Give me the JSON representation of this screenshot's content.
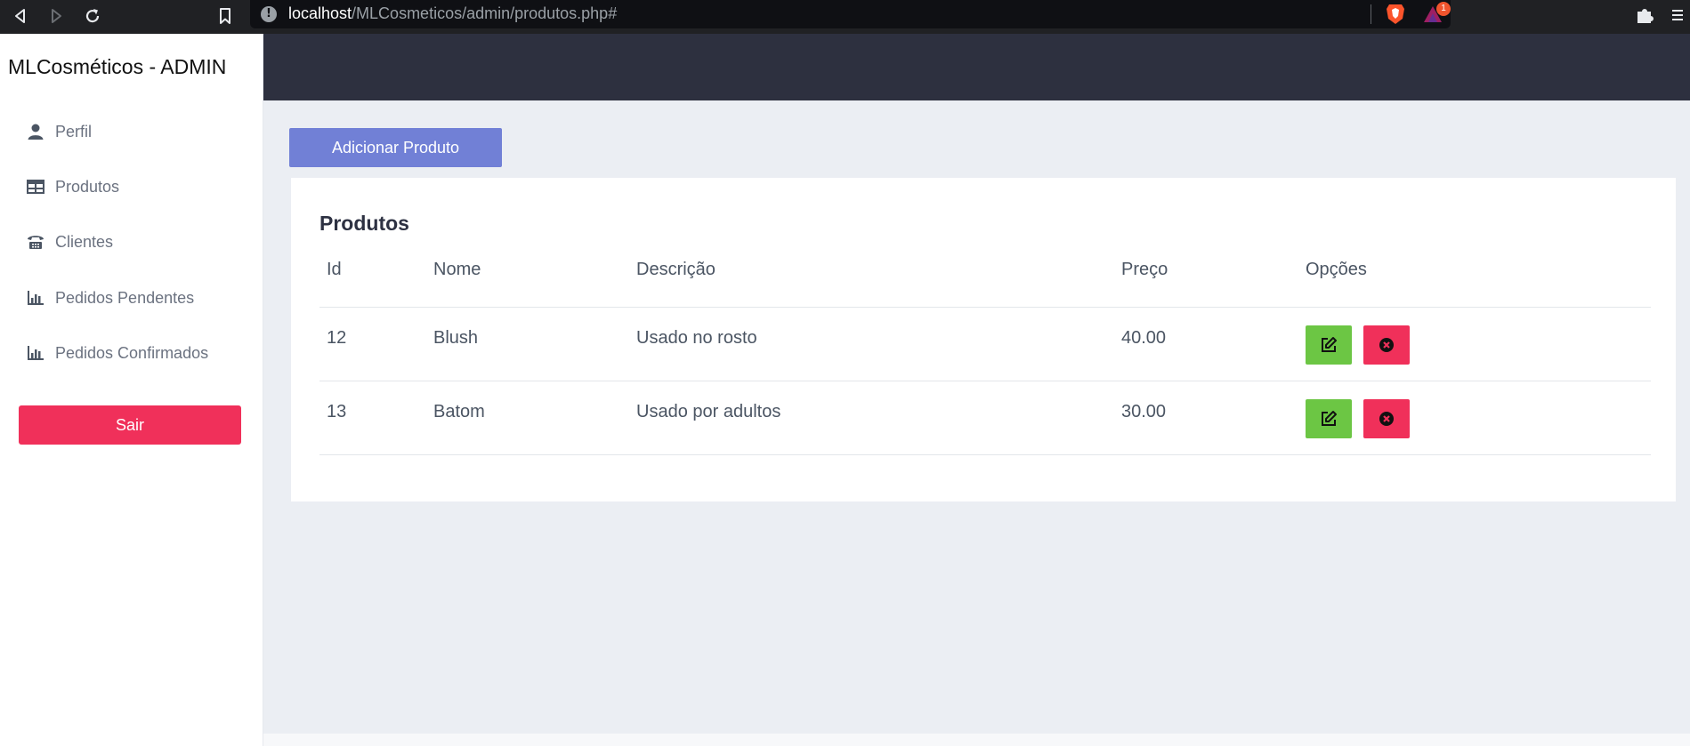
{
  "browser": {
    "url_host": "localhost",
    "url_path": "/MLCosmeticos/admin/produtos.php#",
    "rewards_badge": "1",
    "info_icon": "info-icon",
    "colors": {
      "chrome_bg": "#202124",
      "url_bg": "#0f1014",
      "brave_orange": "#fb542b"
    }
  },
  "sidebar": {
    "brand": "MLCosméticos - ADMIN",
    "items": [
      {
        "label": "Perfil",
        "icon": "user-icon"
      },
      {
        "label": "Produtos",
        "icon": "table-icon"
      },
      {
        "label": "Clientes",
        "icon": "phone-icon"
      },
      {
        "label": "Pedidos Pendentes",
        "icon": "bar-chart-icon"
      },
      {
        "label": "Pedidos Confirmados",
        "icon": "bar-chart-icon"
      }
    ],
    "logout_label": "Sair"
  },
  "main": {
    "add_button_label": "Adicionar Produto",
    "card_title": "Produtos",
    "columns": [
      "Id",
      "Nome",
      "Descrição",
      "Preço",
      "Opções"
    ],
    "rows": [
      {
        "id": "12",
        "nome": "Blush",
        "descricao": "Usado no rosto",
        "preco": "40.00"
      },
      {
        "id": "13",
        "nome": "Batom",
        "descricao": "Usado por adultos",
        "preco": "30.00"
      }
    ],
    "row_actions": [
      {
        "name": "edit",
        "icon": "edit-icon",
        "color": "#6cc644"
      },
      {
        "name": "delete",
        "icon": "close-circle-icon",
        "color": "#f0305a"
      }
    ]
  },
  "colors": {
    "topbar": "#2d303f",
    "main_bg": "#ebeef3",
    "accent_primary": "#7180d6",
    "danger": "#f0305a",
    "success": "#6cc644"
  }
}
